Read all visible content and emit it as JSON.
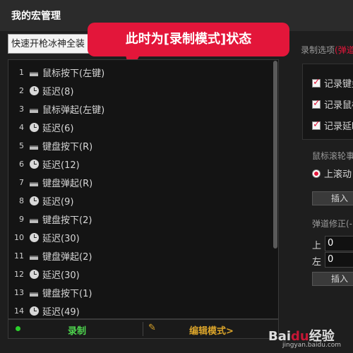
{
  "window": {
    "title": "我的宏管理"
  },
  "macro_select": {
    "value": "快速开枪冰神全装"
  },
  "callout": {
    "text": "此时为[录制模式]状态"
  },
  "steps": [
    {
      "num": "1",
      "icon": "key-icon",
      "label": "鼠标按下(左键)"
    },
    {
      "num": "2",
      "icon": "clock-icon",
      "label": "延迟(8)"
    },
    {
      "num": "3",
      "icon": "key-icon",
      "label": "鼠标弹起(左键)"
    },
    {
      "num": "4",
      "icon": "clock-icon",
      "label": "延迟(6)"
    },
    {
      "num": "5",
      "icon": "key-icon",
      "label": "键盘按下(R)"
    },
    {
      "num": "6",
      "icon": "clock-icon",
      "label": "延迟(12)"
    },
    {
      "num": "7",
      "icon": "key-icon",
      "label": "键盘弹起(R)"
    },
    {
      "num": "8",
      "icon": "clock-icon",
      "label": "延迟(9)"
    },
    {
      "num": "9",
      "icon": "key-icon",
      "label": "键盘按下(2)"
    },
    {
      "num": "10",
      "icon": "clock-icon",
      "label": "延迟(30)"
    },
    {
      "num": "11",
      "icon": "key-icon",
      "label": "键盘弹起(2)"
    },
    {
      "num": "12",
      "icon": "clock-icon",
      "label": "延迟(30)"
    },
    {
      "num": "13",
      "icon": "key-icon",
      "label": "键盘按下(1)"
    },
    {
      "num": "14",
      "icon": "clock-icon",
      "label": "延迟(49)"
    }
  ],
  "bottom": {
    "record_label": "录制",
    "edit_label": "编辑模式>"
  },
  "right": {
    "title": "录制选项",
    "title_highlight": "(弹道",
    "checkboxes": [
      {
        "label": "记录键盘"
      },
      {
        "label": "记录鼠标"
      },
      {
        "label": "记录延时"
      }
    ],
    "wheel_label": "鼠标滚轮事",
    "radio_label": "上滚动",
    "insert_label": "插入",
    "recoil_label": "弹道修正(-",
    "field_up_label": "上",
    "field_up_value": "0",
    "field_left_label": "左",
    "field_left_value": "0",
    "insert2_label": "插入"
  },
  "watermark": {
    "text": "Bai",
    "paw": "du",
    "text2": "经验",
    "sub": "jingyan.baidu.com"
  },
  "colors": {
    "accent": "#e3163a",
    "record": "#4ed44e",
    "edit": "#d9a32a"
  }
}
